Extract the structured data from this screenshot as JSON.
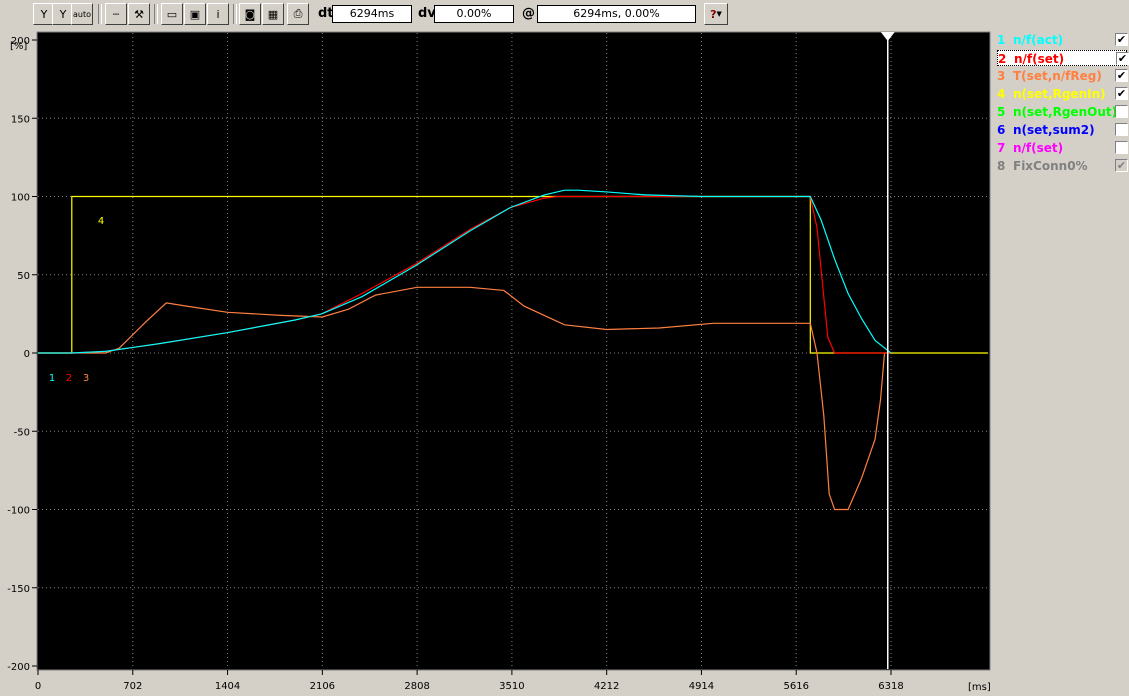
{
  "toolbar": {
    "y_label": "Y",
    "y_auto_label": "auto",
    "dt_label": "dt",
    "dt_value": "6294ms",
    "dv_label": "dv",
    "dv_value": "0.00%",
    "at_label": "@",
    "at_value": "6294ms, 0.00%",
    "help_label": "?"
  },
  "legend": [
    {
      "num": "1",
      "name": "n/f(act)",
      "color": "#00ffff",
      "checked": true,
      "enabled": true
    },
    {
      "num": "2",
      "name": "n/f(set)",
      "color": "#ff0000",
      "checked": true,
      "enabled": true
    },
    {
      "num": "3",
      "name": "T(set,n/fReg)",
      "color": "#ff8040",
      "checked": true,
      "enabled": true
    },
    {
      "num": "4",
      "name": "n(set,RgenIn)",
      "color": "#ffff00",
      "checked": true,
      "enabled": true
    },
    {
      "num": "5",
      "name": "n(set,RgenOut)",
      "color": "#00ff00",
      "checked": false,
      "enabled": true
    },
    {
      "num": "6",
      "name": "n(set,sum2)",
      "color": "#0000ff",
      "checked": false,
      "enabled": true
    },
    {
      "num": "7",
      "name": "n/f(set)",
      "color": "#ff00ff",
      "checked": false,
      "enabled": true
    },
    {
      "num": "8",
      "name": "FixConn0%",
      "color": "#808080",
      "checked": true,
      "enabled": false
    }
  ],
  "chart_data": {
    "type": "line",
    "y_unit": "[%]",
    "x_unit": "[ms]",
    "xlim": [
      0,
      6318
    ],
    "ylim": [
      -200,
      200
    ],
    "x_ticks": [
      0,
      702,
      1404,
      2106,
      2808,
      3510,
      4212,
      4914,
      5616,
      6318
    ],
    "y_ticks": [
      200,
      150,
      100,
      50,
      0,
      -50,
      -100,
      -150,
      -200
    ],
    "grid": true,
    "cursor_x": 6294,
    "series": [
      {
        "name": "n/f(act)",
        "trace": "1",
        "color": "#00ffff",
        "x": [
          0,
          250,
          500,
          900,
          1400,
          1900,
          2100,
          2400,
          2800,
          3200,
          3500,
          3750,
          3900,
          4000,
          4200,
          4500,
          4914,
          5000,
          5300,
          5616,
          5720,
          5800,
          5900,
          6000,
          6100,
          6200,
          6318
        ],
        "y": [
          0,
          0,
          1,
          6,
          13,
          21,
          25,
          36,
          56,
          78,
          93,
          101,
          104,
          104,
          103,
          101,
          100,
          100,
          100,
          100,
          100,
          85,
          60,
          38,
          22,
          8,
          0
        ]
      },
      {
        "name": "n/f(set)",
        "trace": "2",
        "color": "#ff0000",
        "x": [
          0,
          250,
          500,
          900,
          1400,
          1900,
          2100,
          2400,
          2800,
          3200,
          3500,
          3750,
          3850,
          4200,
          4914,
          5616,
          5720,
          5770,
          5810,
          5850,
          5900,
          6318
        ],
        "y": [
          0,
          0,
          1,
          6,
          13,
          21,
          25,
          38,
          57,
          79,
          93,
          99,
          100,
          100,
          100,
          100,
          100,
          80,
          45,
          10,
          0,
          0
        ]
      },
      {
        "name": "T(set,n/fReg)",
        "trace": "3",
        "color": "#ff8040",
        "x": [
          0,
          500,
          600,
          800,
          950,
          1100,
          1404,
          1800,
          2106,
          2300,
          2500,
          2808,
          3200,
          3450,
          3600,
          3900,
          4212,
          4600,
          5000,
          5616,
          5720,
          5770,
          5820,
          5860,
          5900,
          5950,
          6000,
          6100,
          6200,
          6240,
          6270,
          6318
        ],
        "y": [
          0,
          0,
          3,
          20,
          32,
          30,
          26,
          24,
          23,
          28,
          37,
          42,
          42,
          40,
          30,
          18,
          15,
          16,
          19,
          19,
          19,
          0,
          -40,
          -90,
          -100,
          -100,
          -100,
          -80,
          -55,
          -30,
          0,
          0
        ]
      },
      {
        "name": "n(set,RgenIn)",
        "trace": "4",
        "color": "#ffff00",
        "x": [
          0,
          250,
          250,
          5720,
          5720,
          6318
        ],
        "y": [
          0,
          0,
          100,
          100,
          0,
          0
        ]
      }
    ]
  }
}
